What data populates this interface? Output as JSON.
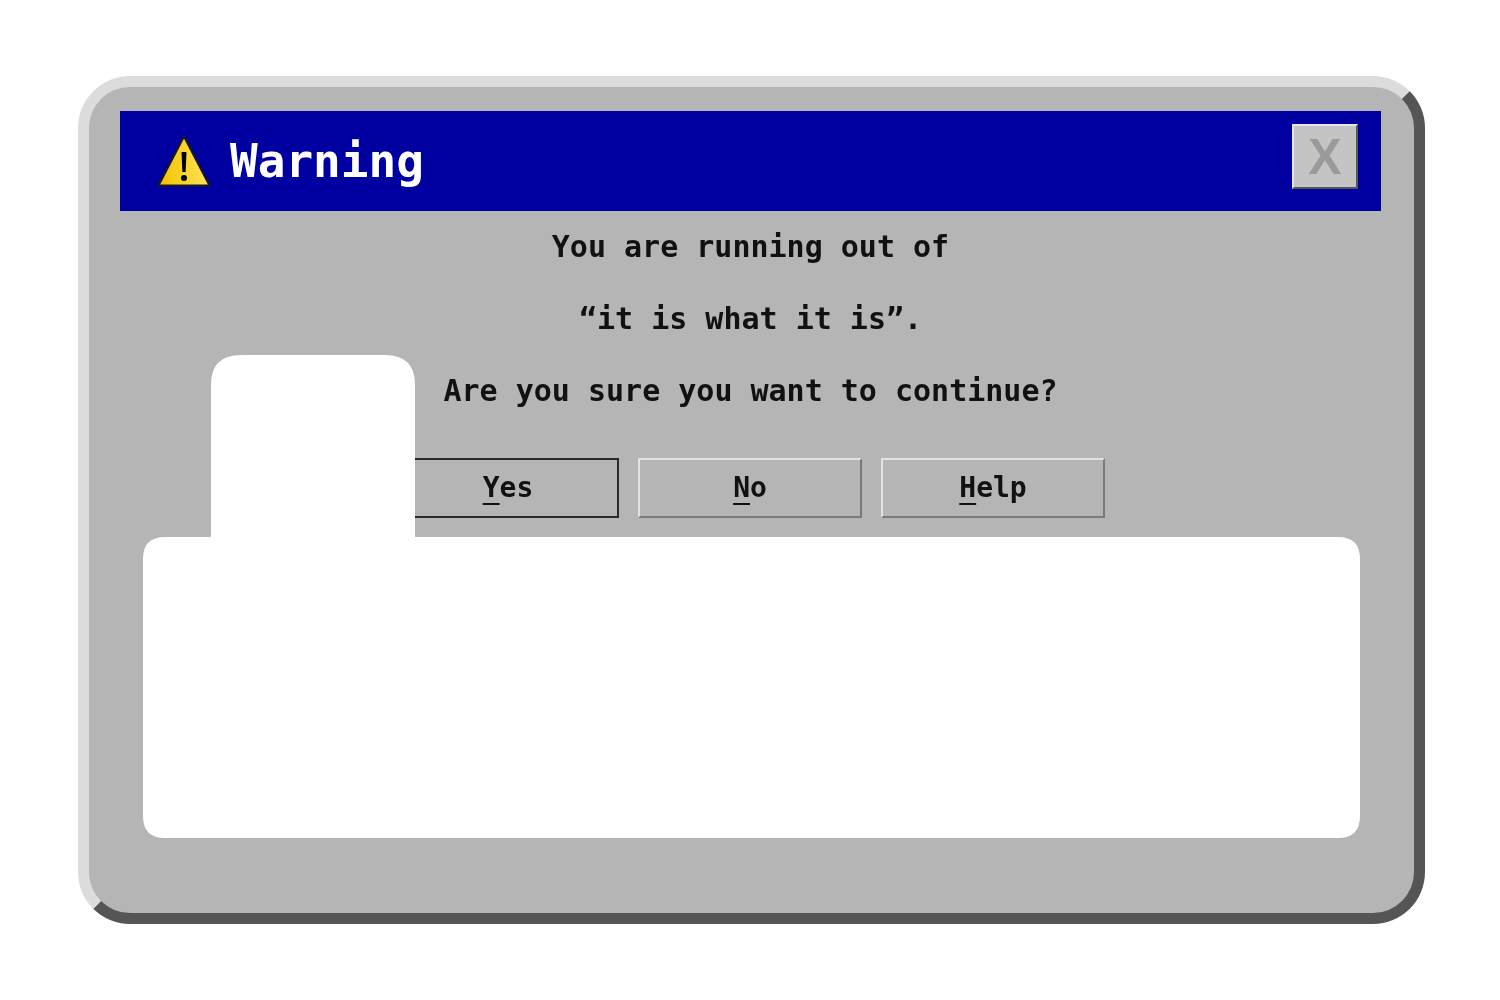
{
  "window": {
    "title": "Warning",
    "close_button": {
      "label": "X",
      "disabled": true
    }
  },
  "message": [
    "You are running out of",
    "“it is what it is”.",
    "Are you sure you want to continue?"
  ],
  "buttons": [
    {
      "label": "Yes",
      "default": true
    },
    {
      "label": "No",
      "default": false
    },
    {
      "label": "Help",
      "default": false
    }
  ]
}
